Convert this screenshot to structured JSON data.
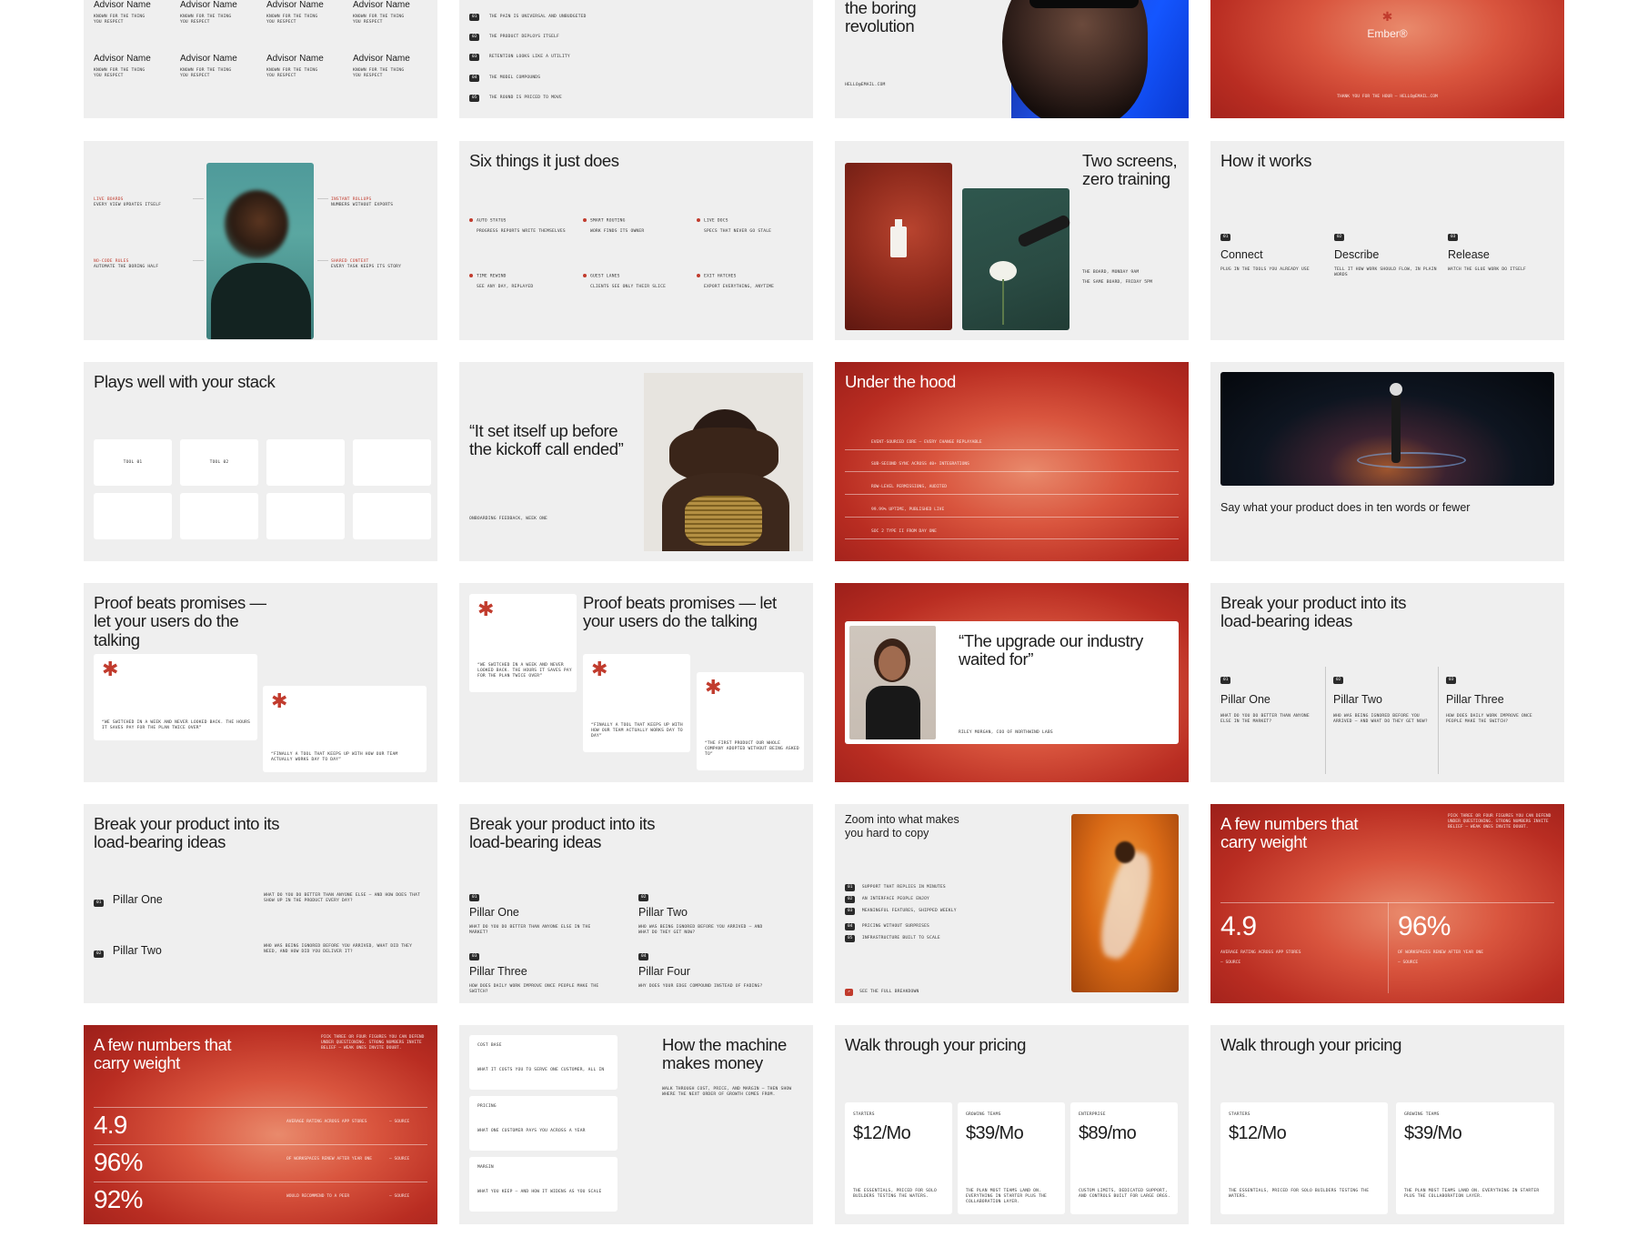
{
  "s1": {
    "cells": [
      {
        "name": "Advisor Name",
        "desc": "Known for the thing you respect"
      },
      {
        "name": "Advisor Name",
        "desc": "Known for the thing you respect"
      },
      {
        "name": "Advisor Name",
        "desc": "Known for the thing you respect"
      },
      {
        "name": "Advisor Name",
        "desc": "Known for the thing you respect"
      },
      {
        "name": "Advisor Name",
        "desc": "Known for the thing you respect"
      },
      {
        "name": "Advisor Name",
        "desc": "Known for the thing you respect"
      },
      {
        "name": "Advisor Name",
        "desc": "Known for the thing you respect"
      },
      {
        "name": "Advisor Name",
        "desc": "Known for the thing you respect"
      }
    ]
  },
  "s2": {
    "items": [
      {
        "n": "01",
        "t": "The pain is universal and unbudgeted"
      },
      {
        "n": "02",
        "t": "The product deploys itself"
      },
      {
        "n": "03",
        "t": "Retention looks like a utility"
      },
      {
        "n": "04",
        "t": "The model compounds"
      },
      {
        "n": "05",
        "t": "The round is priced to move"
      }
    ]
  },
  "s3": {
    "title": "the boring revolution",
    "email": "hello@email.com"
  },
  "s4": {
    "brand": "Ember®",
    "foot": "Thank you for the hour — hello@email.com"
  },
  "s5": {
    "left": [
      {
        "k": "Live boards",
        "v": "Every view updates itself"
      },
      {
        "k": "No-code rules",
        "v": "Automate the boring half"
      }
    ],
    "right": [
      {
        "k": "Instant rollups",
        "v": "Numbers without exports"
      },
      {
        "k": "Shared context",
        "v": "Every task keeps its story"
      }
    ]
  },
  "s6": {
    "title": "Six things it just does",
    "items": [
      {
        "k": "Auto status",
        "v": "Progress reports write themselves"
      },
      {
        "k": "Smart routing",
        "v": "Work finds its owner"
      },
      {
        "k": "Live docs",
        "v": "Specs that never go stale"
      },
      {
        "k": "Time rewind",
        "v": "See any day, replayed"
      },
      {
        "k": "Guest lanes",
        "v": "Clients see only their slice"
      },
      {
        "k": "Exit hatches",
        "v": "Export everything, anytime"
      }
    ]
  },
  "s7": {
    "title": "Two screens, zero training",
    "l1": "The board, Monday 9AM",
    "l2": "The same board, Friday 5PM"
  },
  "s8": {
    "title": "How it works",
    "steps": [
      {
        "n": "01",
        "label": "Connect",
        "desc": "Plug in the tools you already use"
      },
      {
        "n": "02",
        "label": "Describe",
        "desc": "Tell it how work should flow, in plain words"
      },
      {
        "n": "03",
        "label": "Release",
        "desc": "Watch the glue work do itself"
      }
    ]
  },
  "s9": {
    "title": "Plays well with your stack",
    "tools": [
      "Tool 01",
      "Tool 02",
      "",
      "",
      "",
      "",
      "",
      ""
    ]
  },
  "s10": {
    "quote": "“It set itself up before the kickoff call ended”",
    "cite": "Onboarding feedback, week one"
  },
  "s11": {
    "title": "Under the hood",
    "rows": [
      "Event-sourced core — every change replayable",
      "Sub-second sync across 40+ integrations",
      "Row-level permissions, audited",
      "99.99% uptime, published live",
      "SOC 2 Type II from day one"
    ]
  },
  "s12": {
    "caption": "Say what your product does in ten words or fewer"
  },
  "s13": {
    "title": "Proof beats promises — let your users do the talking",
    "q1": "“We switched in a week and never looked back. The hours it saves pay for the plan twice over”",
    "q2": "“Finally a tool that keeps up with how our team actually works day to day”"
  },
  "s14": {
    "title": "Proof beats promises — let your users do the talking",
    "q1": "“We switched in a week and never looked back. The hours it saves pay for the plan twice over”",
    "q2": "“Finally a tool that keeps up with how our team actually works day to day”",
    "q3": "“The first product our whole company adopted without being asked to”"
  },
  "s15": {
    "quote": "“The upgrade our industry waited for”",
    "cite": "Riley Morgan, COO of Northwind Labs"
  },
  "s16": {
    "title": "Break your product into its load-bearing ideas",
    "pillars": [
      {
        "n": "01",
        "label": "Pillar One",
        "desc": "What do you do better than anyone else in the market?"
      },
      {
        "n": "02",
        "label": "Pillar Two",
        "desc": "Who was being ignored before you arrived — and what do they get now?"
      },
      {
        "n": "03",
        "label": "Pillar Three",
        "desc": "How does daily work improve once people make the switch?"
      }
    ]
  },
  "s17": {
    "title": "Break your product into its load-bearing ideas",
    "pillars": [
      {
        "n": "01",
        "label": "Pillar One",
        "desc": "What do you do better than anyone else — and how does that show up in the product every day?"
      },
      {
        "n": "02",
        "label": "Pillar Two",
        "desc": "Who was being ignored before you arrived, what did they need, and how did you deliver it?"
      }
    ]
  },
  "s18": {
    "title": "Break your product into its load-bearing ideas",
    "pillars": [
      {
        "n": "01",
        "label": "Pillar One",
        "desc": "What do you do better than anyone else in the market?"
      },
      {
        "n": "02",
        "label": "Pillar Two",
        "desc": "Who was being ignored before you arrived — and what do they get now?"
      },
      {
        "n": "03",
        "label": "Pillar Three",
        "desc": "How does daily work improve once people make the switch?"
      },
      {
        "n": "04",
        "label": "Pillar Four",
        "desc": "Why does your edge compound instead of fading?"
      }
    ]
  },
  "s19": {
    "title": "Zoom into what makes you hard to copy",
    "items": [
      {
        "n": "01",
        "t": "Support that replies in minutes"
      },
      {
        "n": "02",
        "t": "An interface people enjoy"
      },
      {
        "n": "03",
        "t": "Meaningful features, shipped weekly"
      },
      {
        "n": "04",
        "t": "Pricing without surprises"
      },
      {
        "n": "05",
        "t": "Infrastructure built to scale"
      }
    ],
    "link": "See the full breakdown"
  },
  "s20": {
    "title": "A few numbers that carry weight",
    "note": "Pick three or four figures you can defend under questioning. Strong numbers invite belief — weak ones invite doubt.",
    "stats": [
      {
        "v": "4.9",
        "d": "Average rating across app stores",
        "s": "— Source"
      },
      {
        "v": "96%",
        "d": "Of workspaces renew after year one",
        "s": "— Source"
      }
    ]
  },
  "s21": {
    "title": "A few numbers that carry weight",
    "note": "Pick three or four figures you can defend under questioning. Strong numbers invite belief — weak ones invite doubt.",
    "stats": [
      {
        "v": "4.9",
        "d": "Average rating across app stores",
        "s": "— Source"
      },
      {
        "v": "96%",
        "d": "Of workspaces renew after year one",
        "s": "— Source"
      },
      {
        "v": "92%",
        "d": "Would recommend to a peer",
        "s": "— Source"
      }
    ]
  },
  "s22": {
    "title": "How the machine makes money",
    "desc": "Walk through cost, price, and margin — then show where the next order of growth comes from.",
    "rows": [
      {
        "k": "Cost Base",
        "v": "What it costs you to serve one customer, all in"
      },
      {
        "k": "Pricing",
        "v": "What one customer pays you across a year"
      },
      {
        "k": "Margin",
        "v": "What you keep — and how it widens as you scale"
      }
    ]
  },
  "s23": {
    "title": "Walk through your pricing",
    "tiers": [
      {
        "k": "Starters",
        "p": "$12/Mo",
        "d": "The essentials, priced for solo builders testing the waters."
      },
      {
        "k": "Growing teams",
        "p": "$39/Mo",
        "d": "The plan most teams land on. Everything in Starter plus the collaboration layer."
      },
      {
        "k": "Enterprise",
        "p": "$89/mo",
        "d": "Custom limits, dedicated support, and controls built for large orgs."
      }
    ]
  },
  "s24": {
    "title": "Walk through your pricing",
    "tiers": [
      {
        "k": "Starters",
        "p": "$12/Mo",
        "d": "The essentials, priced for solo builders testing the waters."
      },
      {
        "k": "Growing teams",
        "p": "$39/Mo",
        "d": "The plan most teams land on. Everything in Starter plus the collaboration layer."
      }
    ]
  },
  "colors": {
    "accent": "#c13b2d",
    "slideBg": "#efefef",
    "redDeep": "#9c1f1a"
  }
}
